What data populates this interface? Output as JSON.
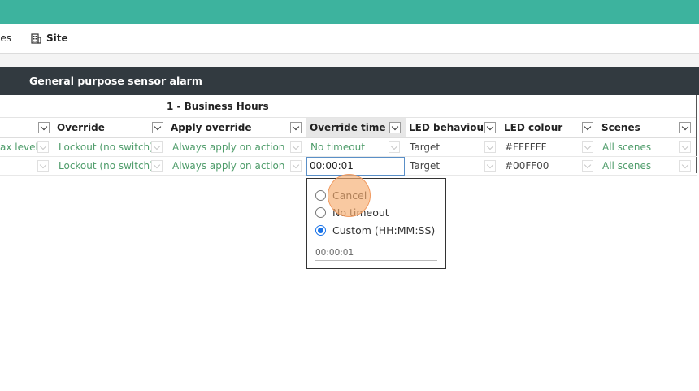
{
  "toolbar": {
    "files_label": "les",
    "site_label": "Site"
  },
  "panel": {
    "title": "General purpose sensor alarm"
  },
  "group": {
    "label": "1 - Business Hours"
  },
  "columns": [
    {
      "label": "",
      "key": "prev"
    },
    {
      "label": "Override",
      "key": "override"
    },
    {
      "label": "Apply override",
      "key": "apply_override"
    },
    {
      "label": "Override time",
      "key": "override_time"
    },
    {
      "label": "LED behaviour",
      "key": "led_behaviour"
    },
    {
      "label": "LED colour",
      "key": "led_colour"
    },
    {
      "label": "Scenes",
      "key": "scenes"
    }
  ],
  "rows": [
    {
      "prev": "ax level",
      "override": "Lockout (no switch)",
      "apply_override": "Always apply on action",
      "override_time": "No timeout",
      "led_behaviour": "Target",
      "led_colour": "#FFFFFF",
      "scenes": "All scenes"
    },
    {
      "prev": "",
      "override": "Lockout (no switch)",
      "apply_override": "Always apply on action",
      "override_time": "00:00:01",
      "led_behaviour": "Target",
      "led_colour": "#00FF00",
      "scenes": "All scenes"
    }
  ],
  "popup": {
    "options": [
      {
        "label": "Cancel",
        "selected": false
      },
      {
        "label": "No timeout",
        "selected": false
      },
      {
        "label": "Custom (HH:MM:SS)",
        "selected": true
      }
    ],
    "custom_value": "00:00:01"
  },
  "colors": {
    "topbar": "#3db39e",
    "panel_header": "#323a40",
    "cell_text_green": "#4e9c6a",
    "radio_selected": "#1a73e8",
    "click_highlight": "#f6ac6e"
  },
  "icons": {
    "site": "site-building-icon",
    "dropdown": "chevron-down-icon"
  }
}
